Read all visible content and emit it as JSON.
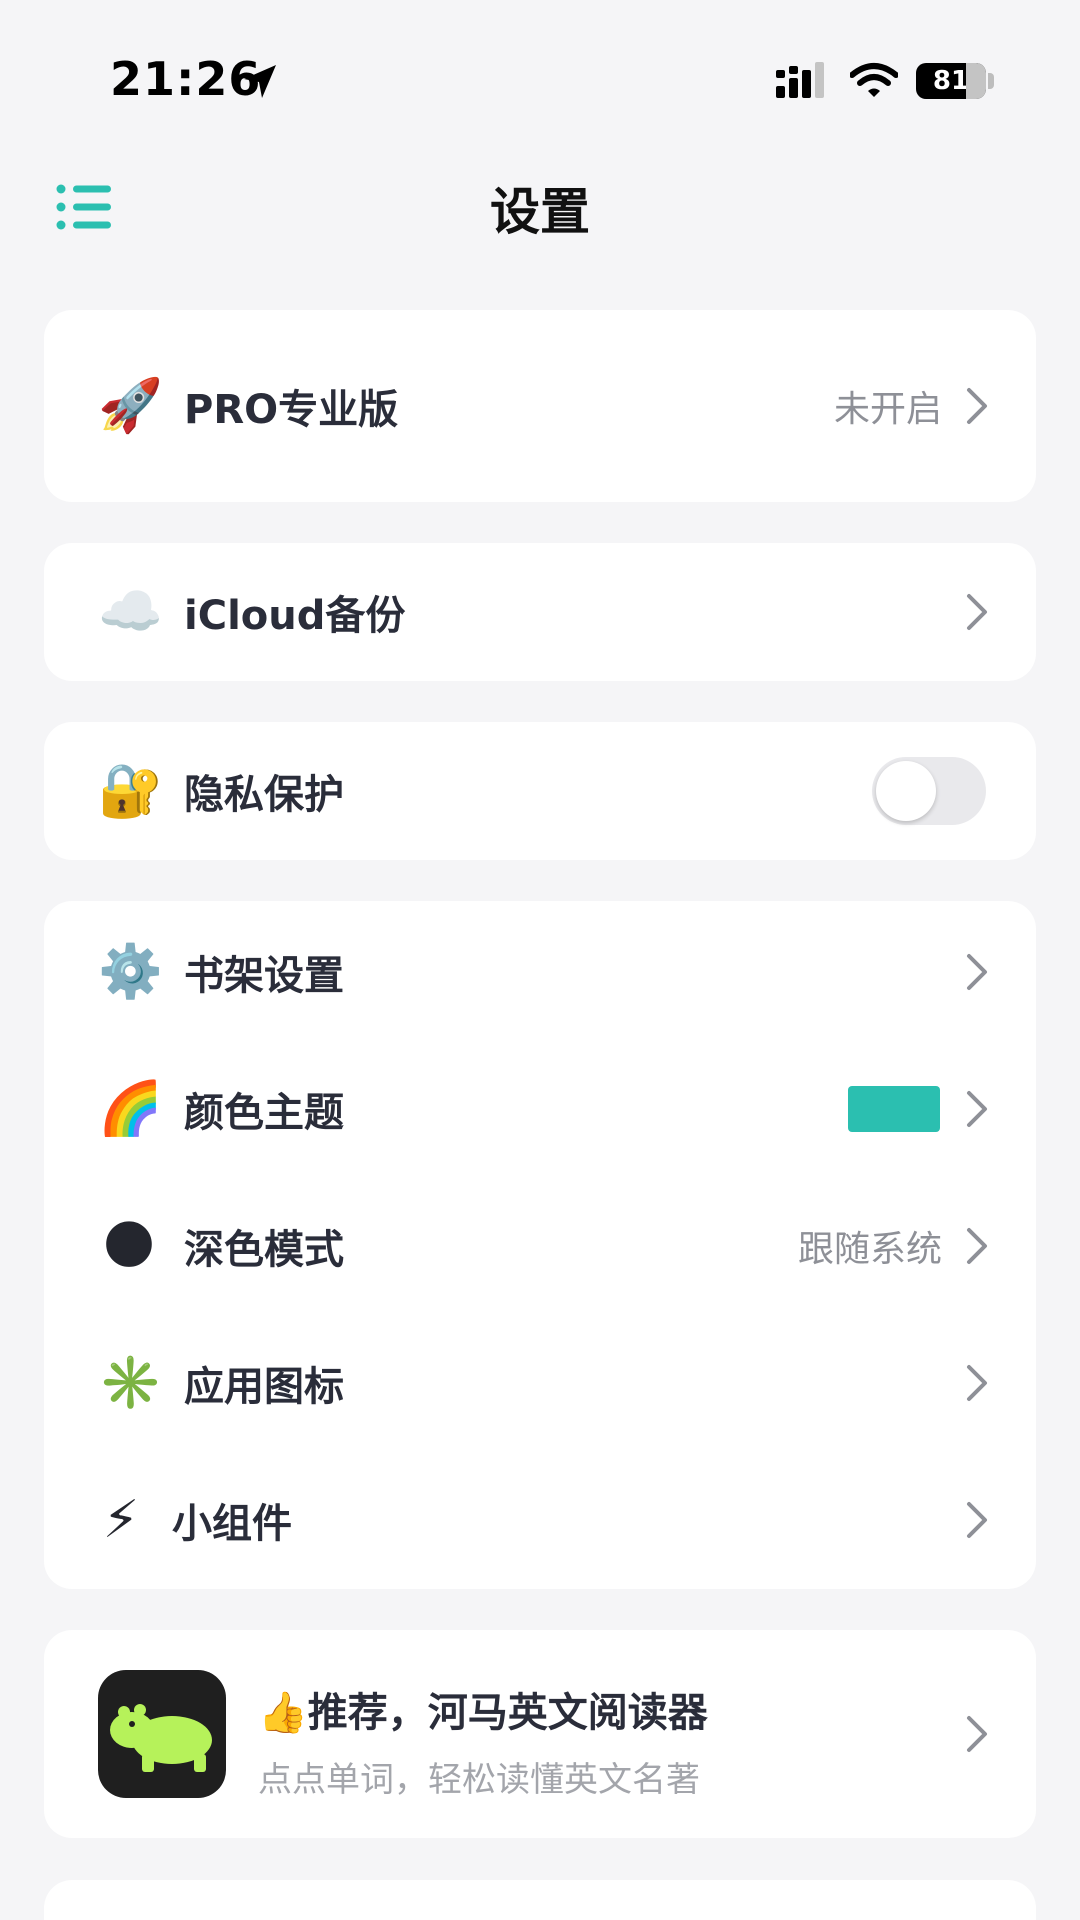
{
  "status_bar": {
    "time": "21:26",
    "battery": "81"
  },
  "header": {
    "title": "设置"
  },
  "rows": {
    "pro": {
      "emoji": "🚀",
      "label": "PRO专业版",
      "value": "未开启"
    },
    "icloud": {
      "emoji": "☁️",
      "label": "iCloud备份"
    },
    "privacy": {
      "emoji": "🔐",
      "label": "隐私保护",
      "enabled": false
    },
    "bookshelf": {
      "emoji": "⚙️",
      "label": "书架设置"
    },
    "theme": {
      "emoji": "🌈",
      "label": "颜色主题",
      "swatch_color": "#2bbfb0"
    },
    "dark_mode": {
      "emoji": "🌑",
      "label": "深色模式",
      "value": "跟随系统"
    },
    "app_icon": {
      "emoji": "✳️",
      "label": "应用图标"
    },
    "widget": {
      "emoji": "⚡",
      "label": "小组件"
    }
  },
  "promo": {
    "title": "👍推荐，河马英文阅读器",
    "subtitle": "点点单词，轻松读懂英文名著"
  },
  "colors": {
    "accent": "#2bbfb0",
    "background": "#f5f5f7"
  }
}
